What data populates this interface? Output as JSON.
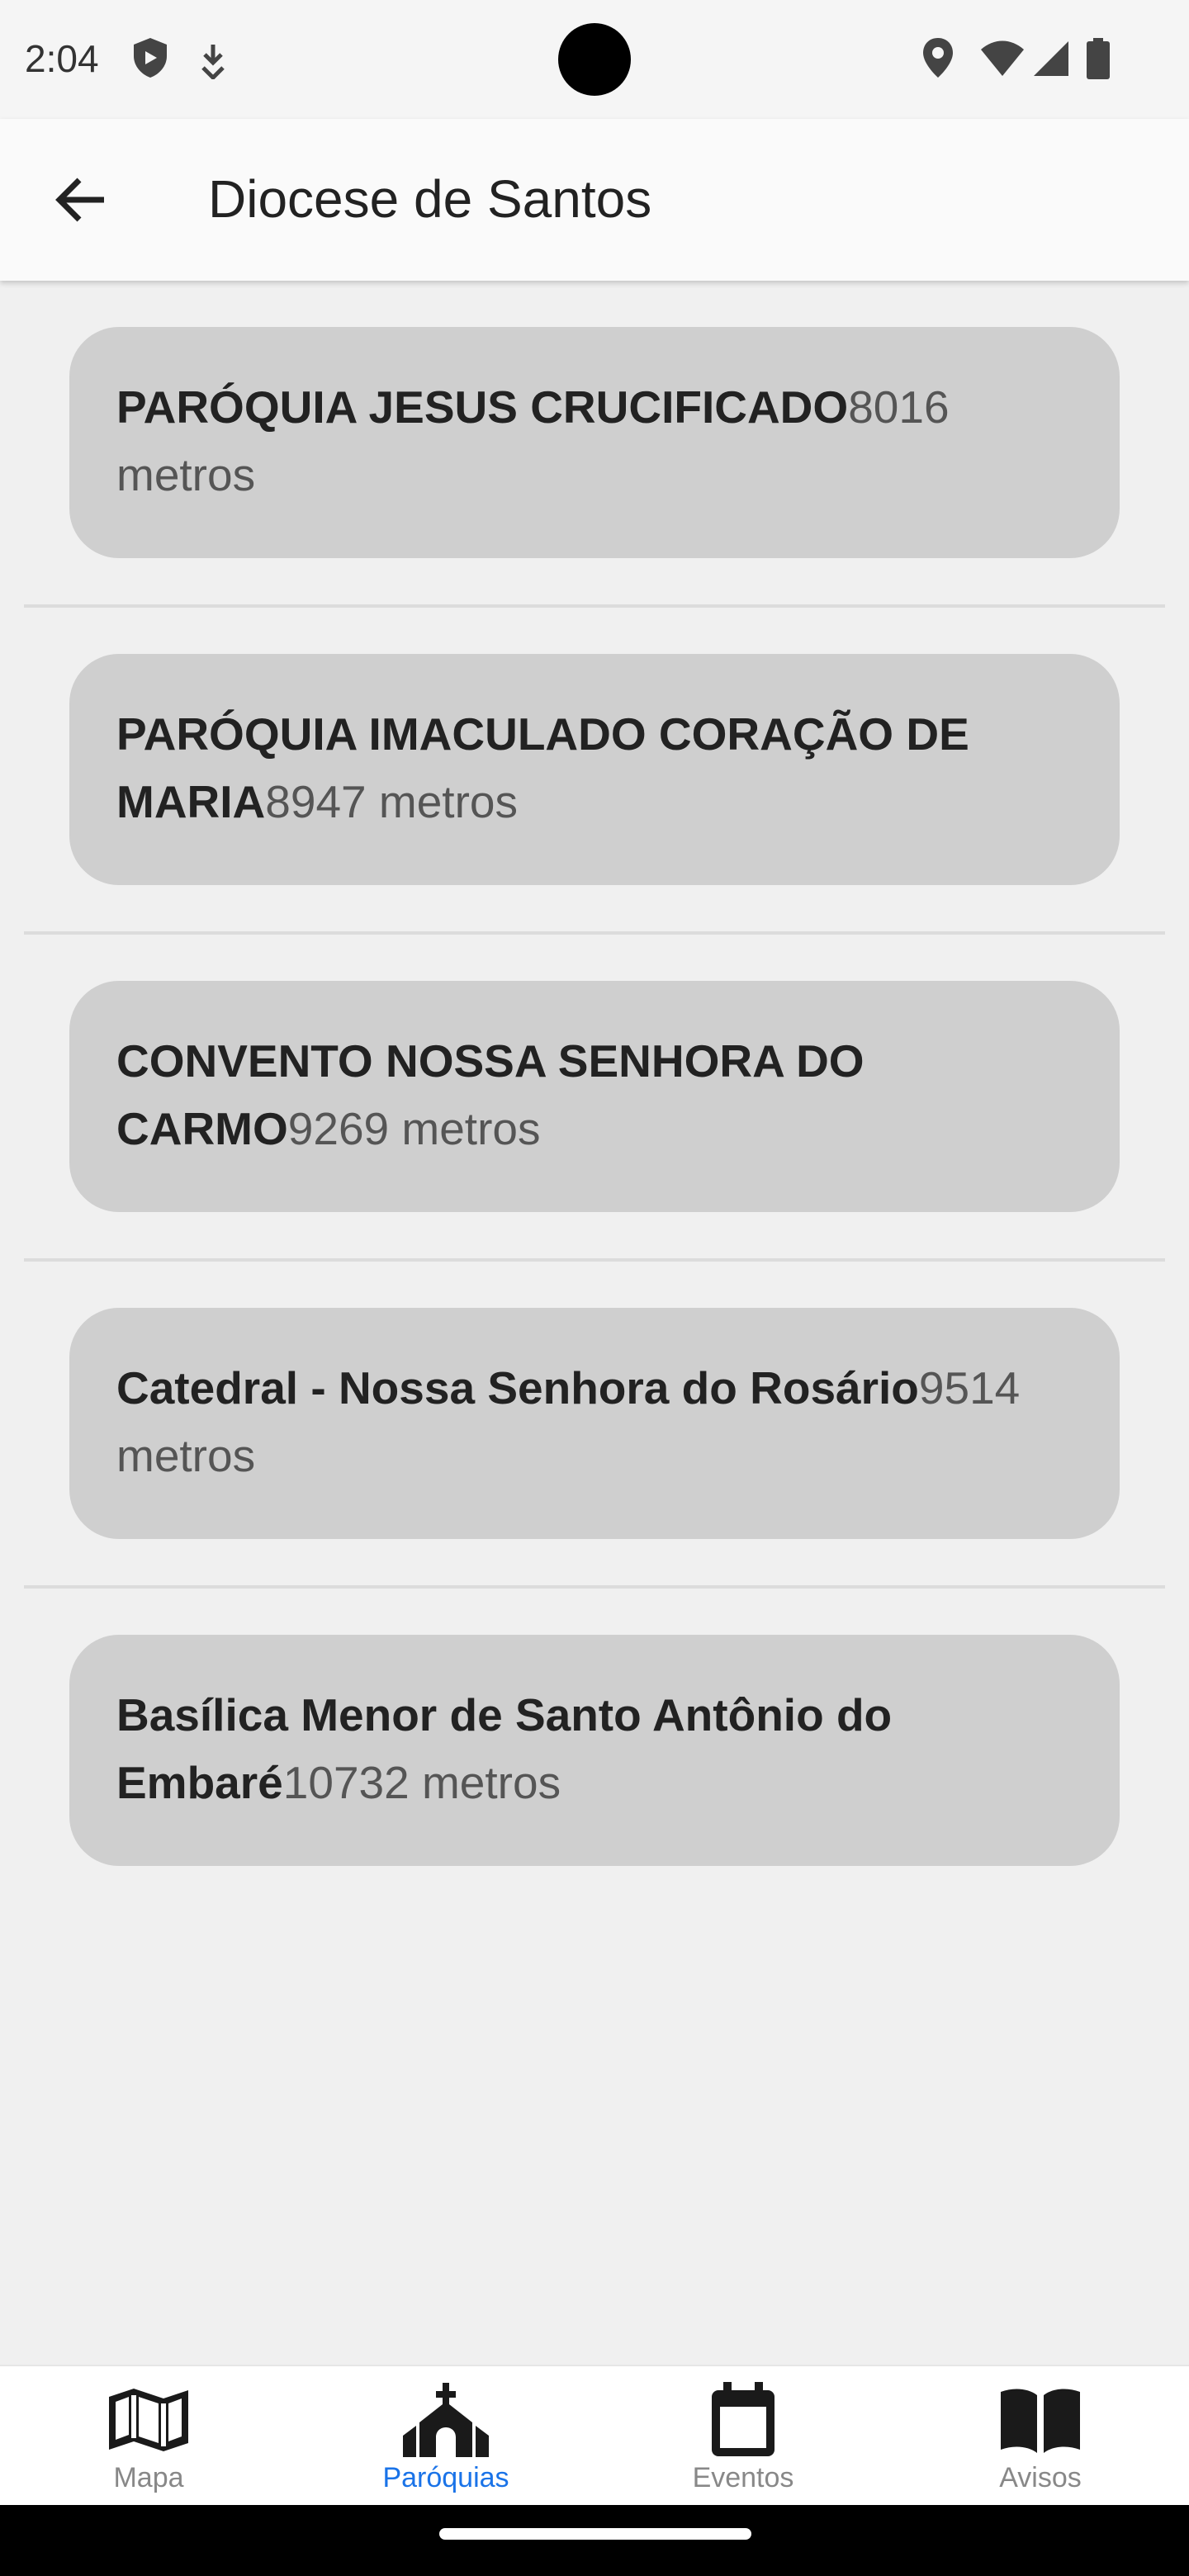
{
  "status_bar": {
    "time": "2:04",
    "icons": [
      "shield-icon",
      "download-icon",
      "location-icon",
      "wifi-icon",
      "signal-icon",
      "battery-icon"
    ]
  },
  "app_bar": {
    "back_icon": "arrow-back-icon",
    "title": "Diocese de Santos"
  },
  "parishes": [
    {
      "name": "PARÓQUIA JESUS CRUCIFICADO",
      "distance": "8016 metros"
    },
    {
      "name": "PARÓQUIA IMACULADO CORAÇÃO DE MARIA",
      "distance": "8947 metros"
    },
    {
      "name": "CONVENTO NOSSA SENHORA DO CARMO",
      "distance": "9269 metros"
    },
    {
      "name": "Catedral - Nossa Senhora do Rosário",
      "distance": "9514 metros"
    },
    {
      "name": "Basílica Menor de Santo Antônio do Embaré",
      "distance": "10732 metros"
    }
  ],
  "bottom_nav": {
    "items": [
      {
        "label": "Mapa",
        "icon": "map-icon",
        "active": false
      },
      {
        "label": "Paróquias",
        "icon": "church-icon",
        "active": true
      },
      {
        "label": "Eventos",
        "icon": "calendar-icon",
        "active": false
      },
      {
        "label": "Avisos",
        "icon": "book-icon",
        "active": false
      }
    ],
    "active_color": "#1a73e8",
    "inactive_color": "#888888"
  },
  "colors": {
    "background": "#f0f0f0",
    "card": "#cfcfcf"
  }
}
